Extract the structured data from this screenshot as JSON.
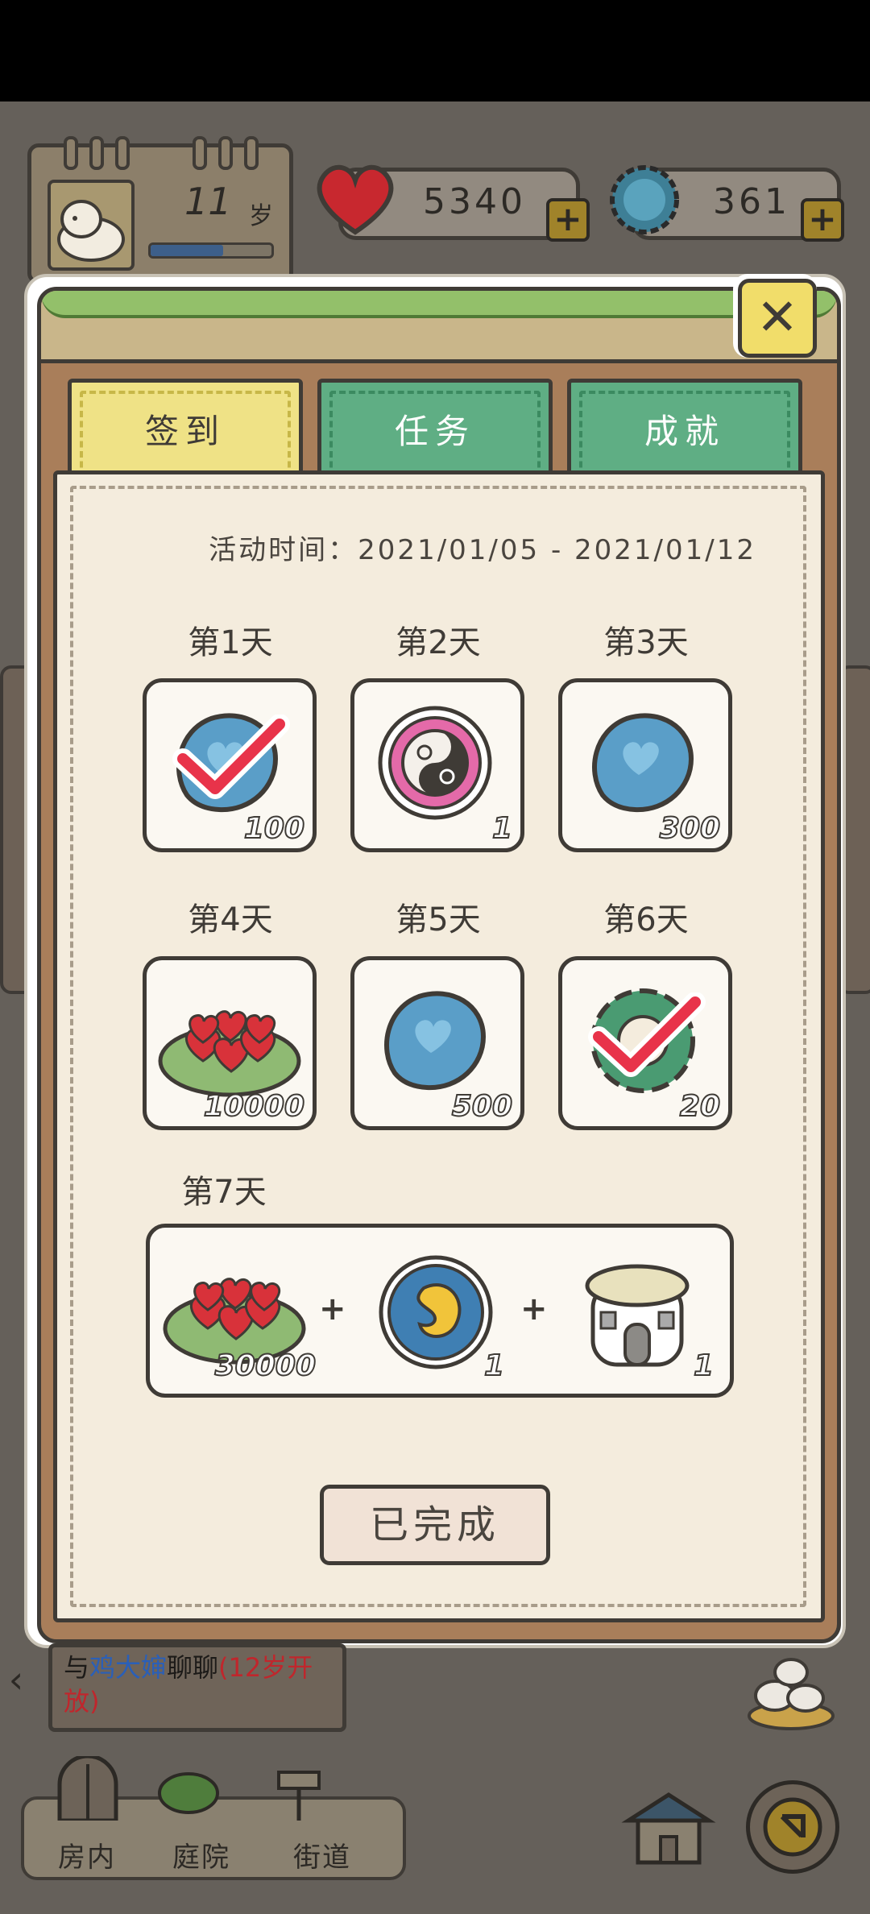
{
  "hud": {
    "age_number": "11",
    "age_unit": "岁",
    "age_progress": 0.6,
    "hearts": "5340",
    "caps": "361",
    "plus": "+"
  },
  "dialog": {
    "close": "✕",
    "tabs": [
      "签到",
      "任务",
      "成就"
    ],
    "activity_time": "活动时间：2021/01/05 - 2021/01/12",
    "days": [
      {
        "label": "第1天",
        "count": "100",
        "item": "blue-cap-icon",
        "claimed": true
      },
      {
        "label": "第2天",
        "count": "1",
        "item": "gender-yin-yang-icon",
        "claimed": false
      },
      {
        "label": "第3天",
        "count": "300",
        "item": "blue-cap-icon",
        "claimed": false
      },
      {
        "label": "第4天",
        "count": "10000",
        "item": "hearts-plate-icon",
        "claimed": false
      },
      {
        "label": "第5天",
        "count": "500",
        "item": "blue-cap-icon",
        "claimed": false
      },
      {
        "label": "第6天",
        "count": "20",
        "item": "green-gear-icon",
        "claimed": true
      }
    ],
    "day7": {
      "label": "第7天",
      "items": [
        {
          "count": "30000",
          "item": "hearts-plate-icon"
        },
        {
          "count": "1",
          "item": "embryo-icon"
        },
        {
          "count": "1",
          "item": "dome-house-icon"
        }
      ],
      "plus": "+"
    },
    "done_button": "已完成"
  },
  "chat": {
    "text_prefix": "与",
    "name": "鸡大婶",
    "text_mid": "聊聊",
    "note": "(12岁开放)",
    "arrow": "‹"
  },
  "nav": {
    "items": [
      "房内",
      "庭院",
      "街道"
    ]
  },
  "colors": {
    "tab_active": "#efe286",
    "tab_inactive": "#5fae84",
    "panel_bg": "#f4ecdd",
    "frame_brown": "#a97e5a",
    "cap_blue": "#5a9ec8",
    "heart_red": "#d83a40",
    "check_red": "#e8334a"
  }
}
